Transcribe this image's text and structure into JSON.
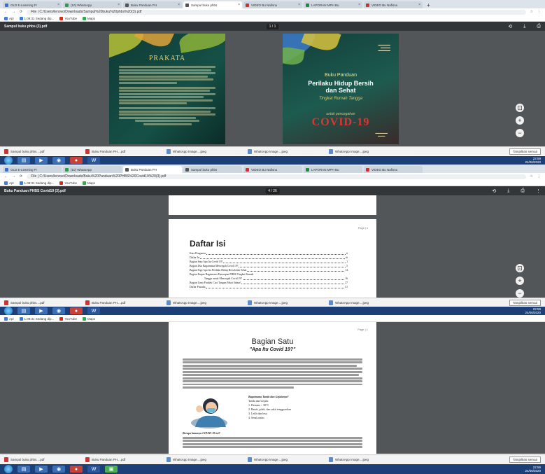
{
  "browser": {
    "tabs": [
      {
        "label": "OLD E-Learning Fr",
        "color": "#3b6fd8"
      },
      {
        "label": "(10) WhatsApp",
        "color": "#25a244"
      },
      {
        "label": "Buku Panduan PH",
        "color": "#555555"
      },
      {
        "label": "Sampul buku phbs",
        "color": "#555555"
      },
      {
        "label": "VIDEO Bu Nafisnu",
        "color": "#d32f2f"
      },
      {
        "label": "LAPORAN MPH Bu",
        "color": "#1e8e3e"
      },
      {
        "label": "VIDEO Bu Nafisnu",
        "color": "#d32f2f"
      }
    ],
    "new_tab": "+",
    "bookmarks": [
      {
        "label": "Apl",
        "color": "#4a7bd6"
      },
      {
        "label": "1.09:31 Sedang dip...",
        "color": "#3b7be0"
      },
      {
        "label": "YouTube",
        "color": "#e62117"
      },
      {
        "label": "Maps",
        "color": "#34a853"
      }
    ]
  },
  "shot1": {
    "url": "File | C:/Users/lenovo/Downloads/Sampul%20buku%20phbs%20(3).pdf",
    "pdf_title": "Sampul buku phbs (3).pdf",
    "page_indicator": "1 / 1",
    "prakata": {
      "title": "PRAKATA"
    },
    "cover": {
      "label": "Buku Panduan",
      "title_line1": "Perilaku Hidup Bersih",
      "title_line2": "dan Sehat",
      "subtitle": "Tingkat Rumah Tangga",
      "untuk": "untuk pencegahan",
      "covid": "COVID-19"
    }
  },
  "shot2": {
    "url": "File | C:/Users/lenovo/Downloads/Buku%20Panduan%20PHBS%20Covid19%20(3).pdf",
    "pdf_title": "Buku Panduan PHBS Covid19 (3).pdf",
    "page_indicator": "4 / 26",
    "page_number": "Page | ii",
    "toc_heading": "Daftar Isi",
    "toc": [
      {
        "t": "Kata Pengantar",
        "n": "ii"
      },
      {
        "t": "Daftar Isi",
        "n": "iii"
      },
      {
        "t": "Bagian Satu    Apa Itu Covid 19? ",
        "n": "1"
      },
      {
        "t": "Bagian Dua    Bagaimana Mencegah Covid 19? ",
        "n": "5"
      },
      {
        "t": "Bagian Tiga    Apa Itu Perilaku Hidup Bersih dan Sehat ",
        "n": "14"
      },
      {
        "t": "Bagian Empat  Bagaimana Penerapan PHBS Tingkat Rumah",
        "n": ""
      },
      {
        "t": "                      Tangga untuk Mencegah Covid 19? ",
        "n": "16"
      },
      {
        "t": "Bagian Lima   Praktek Cuci Tangan Pakai Sabun! ",
        "n": "27"
      },
      {
        "t": "Daftar Pustaka ",
        "n": "41"
      }
    ]
  },
  "shot3": {
    "page_number": "Page | 1",
    "heading": "Bagian Satu",
    "subheading": "\"Apa Itu Covid 19?\"",
    "q1": "Bagaimana Tanda dan Gejalanya?",
    "symptoms_intro": "Tanda dan Gejala:",
    "symptoms": [
      "1. Demam > 38°C",
      "2. Batuk, pilek, dan sakit tenggorokan",
      "3. Letih dan lesu",
      "4. Sesak nafas"
    ],
    "q2": "Berapa lamanya COVID-19 ini?"
  },
  "downloads": [
    {
      "label": "Sampul buku phbs....pdf",
      "kind": "pdf"
    },
    {
      "label": "Buku Panduan PH....pdf",
      "kind": "pdf"
    },
    {
      "label": "WhatsApp Image....jpeg",
      "kind": "img"
    },
    {
      "label": "WhatsApp Image....jpeg",
      "kind": "img"
    },
    {
      "label": "WhatsApp Image....jpeg",
      "kind": "img"
    }
  ],
  "show_all": "Tampilkan semua",
  "taskbar": {
    "time": "22:59",
    "date": "24/06/2020"
  },
  "colors": {
    "viewer_bg": "#525659",
    "pdf_toolbar": "#323639",
    "taskbar": "#1d3f78",
    "covid_red": "#e3322f"
  }
}
